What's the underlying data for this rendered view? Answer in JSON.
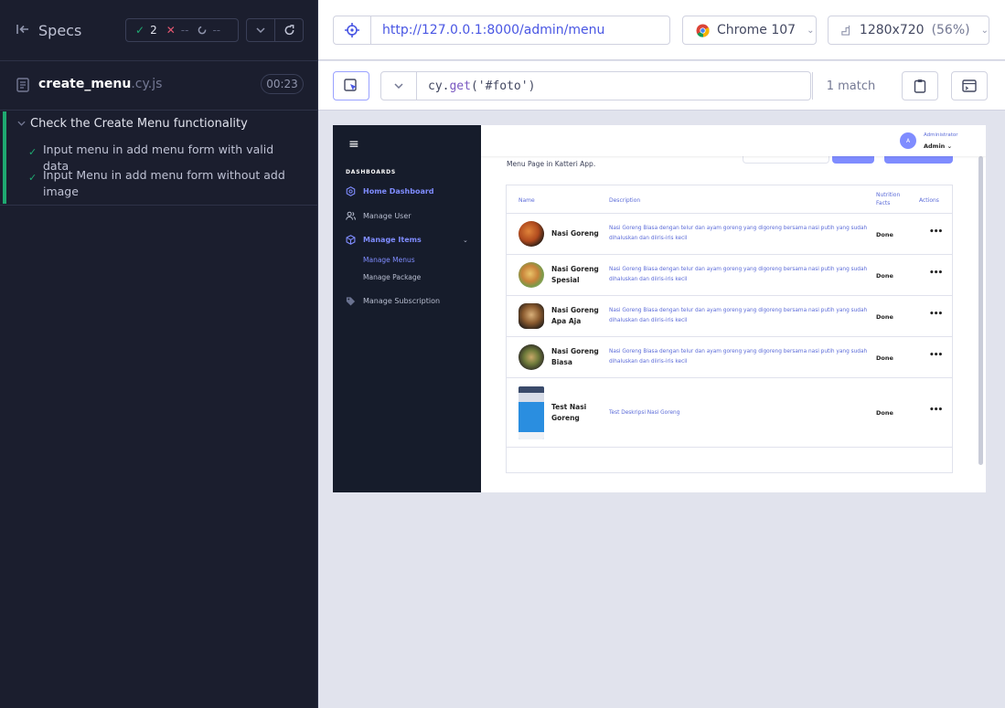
{
  "reporter": {
    "specs_label": "Specs",
    "stats": {
      "passed": "2",
      "failed": "--",
      "pending": "--"
    },
    "file": {
      "name": "create_menu",
      "ext": ".cy.js",
      "duration": "00:23"
    },
    "suite": {
      "title": "Check the Create Menu functionality",
      "tests": [
        {
          "title": "Input menu in add menu form with valid data"
        },
        {
          "title": "Input Menu in add menu form without add image"
        }
      ]
    }
  },
  "runner": {
    "url": "http://127.0.0.1:8000/admin/menu",
    "browser": "Chrome 107",
    "viewport": "1280x720",
    "viewport_scale": "(56%)",
    "selector": {
      "prefix": "cy.",
      "fn": "get",
      "arg": "('#foto')",
      "matches": "1 match"
    }
  },
  "app": {
    "sidebar": {
      "group": "DASHBOARDS",
      "items": [
        {
          "label": "Home Dashboard",
          "icon": "dashboard-icon",
          "active": true
        },
        {
          "label": "Manage User",
          "icon": "users-icon",
          "active": false
        },
        {
          "label": "Manage Items",
          "icon": "cube-icon",
          "active": true
        },
        {
          "label": "Manage Subscription",
          "icon": "tag-icon",
          "active": false
        }
      ],
      "subitems": [
        {
          "label": "Manage Menus",
          "active": true
        },
        {
          "label": "Manage Package",
          "active": false
        }
      ]
    },
    "user": {
      "avatar": "A",
      "role": "Administrator",
      "name": "Admin"
    },
    "page_subtitle": "Menu Page in Katteri App.",
    "table": {
      "headers": {
        "name": "Name",
        "description": "Description",
        "nutrition": "Nutrition Facts",
        "actions": "Actions"
      },
      "rows": [
        {
          "name": "Nasi Goreng",
          "desc": "Nasi Goreng Biasa dengan telur dan ayam goreng yang digoreng bersama nasi putih yang sudah dihaluskan dan diiris-iris kecil",
          "nutrition": "Done",
          "actions": "•••"
        },
        {
          "name": "Nasi Goreng Spesial",
          "desc": "Nasi Goreng Biasa dengan telur dan ayam goreng yang digoreng bersama nasi putih yang sudah dihaluskan dan diiris-iris kecil",
          "nutrition": "Done",
          "actions": "•••"
        },
        {
          "name": "Nasi Goreng Apa Aja",
          "desc": "Nasi Goreng Biasa dengan telur dan ayam goreng yang digoreng bersama nasi putih yang sudah dihaluskan dan diiris-iris kecil",
          "nutrition": "Done",
          "actions": "•••"
        },
        {
          "name": "Nasi Goreng Biasa",
          "desc": "Nasi Goreng Biasa dengan telur dan ayam goreng yang digoreng bersama nasi putih yang sudah dihaluskan dan diiris-iris kecil",
          "nutrition": "Done",
          "actions": "•••"
        },
        {
          "name": "Test Nasi Goreng",
          "desc": "Test Deskripsi Nasi Goreng",
          "nutrition": "Done",
          "actions": "•••"
        }
      ]
    }
  },
  "colors": {
    "pass": "#1fa971",
    "fail": "#e45770",
    "accent": "#4956e3",
    "app_accent": "#7f8cff"
  }
}
